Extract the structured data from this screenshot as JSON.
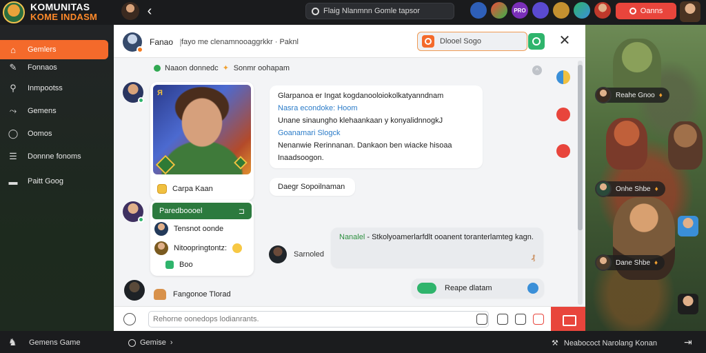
{
  "topbar": {
    "logo_line1": "KOMUNITAS",
    "logo_line2": "KOME INDASM",
    "back_glyph": "‹",
    "search_text": "Flaig Nlanmnn   Gomle tapsor",
    "cta_label": "Oanns",
    "icons": [
      "avatar-red-icon",
      "game-green-icon",
      "pro-badge-icon",
      "game-purple-icon",
      "avatar-gold-icon",
      "game-teal-icon",
      "avatar-user-icon"
    ],
    "pro_label": "PRO"
  },
  "sidebar": {
    "items": [
      {
        "label": "Gemlers",
        "icon": "home-icon",
        "active": true
      },
      {
        "label": "Fonnaos",
        "icon": "controller-icon",
        "active": false
      },
      {
        "label": "Inmpootss",
        "icon": "search-icon",
        "active": false
      },
      {
        "label": "Gemens",
        "icon": "share-icon",
        "active": false
      },
      {
        "label": "Oomos",
        "icon": "chat-icon",
        "active": false
      },
      {
        "label": "Donnne fonoms",
        "icon": "list-icon",
        "active": false
      },
      {
        "label": "Paitt Goog",
        "icon": "inbox-icon",
        "active": false
      }
    ]
  },
  "chat": {
    "header": {
      "name": "Fanao",
      "separator": "|",
      "subtitle": "fayo me clenamnooaggrkkr  ·  Paknl",
      "search_text": "Dlooel Sogo",
      "close_glyph": "✕"
    },
    "pinned": {
      "text1": "Naaon donnedc",
      "text2": "Sonmr oohapam",
      "dismiss_glyph": "^"
    },
    "card1": {
      "footer_label": "Carpa Kaan",
      "badge_text": "Я"
    },
    "bubble1": {
      "line1": "Glarpanoa er Ingat kogdanooloiokolkatyanndnam",
      "line2": "Nasra econdoke: Hoom",
      "line3": "Unane sinaungho klehaankaan y konyalidnnogkJ",
      "line4": "Goanamari Slogck",
      "line5": "Nenanwie Rerinnanan. Dankaon ben wiacke hisoaa",
      "line6": "Inaadsoogon."
    },
    "bubble2": {
      "text": "Daegr Sopoilnaman"
    },
    "card2": {
      "header": "Paredboooel",
      "header_icon": "⊐",
      "row1": "Tensnot oonde",
      "row2": "Nitoopringtontz:",
      "row3": "Boo"
    },
    "sys_row": {
      "name": "Sarnoled"
    },
    "bubble3": {
      "highlight": "Nanalel",
      "text": " - Stkolyoamerlarfdlt ooanent toranterlamteg kagn.",
      "end_mark": "₰"
    },
    "bubble4": {
      "text": "Reape dlatam"
    },
    "last": {
      "name": "Fangonoe Tlorad"
    },
    "composer": {
      "placeholder": "Rehorne oonedops lodianrants."
    },
    "side_icons": [
      "clock-icon",
      "shield-red-icon",
      "heart-red-icon"
    ]
  },
  "game": {
    "chips": [
      {
        "label": "Reahe Gnoo"
      },
      {
        "label": "Onhe Shbe"
      },
      {
        "label": "Dane Shbe"
      }
    ],
    "flame": "♦"
  },
  "bottombar": {
    "left_label": "Gemens Game",
    "mid_label": "Gemise",
    "mid_chevron": "›",
    "right_label": "Neabococt Narolang Konan"
  },
  "colors": {
    "accent": "#f46a2b",
    "danger": "#e8453c",
    "online": "#2fb46c",
    "link_blue": "#2a7bc8",
    "card_header_green": "#2c7a3e"
  }
}
